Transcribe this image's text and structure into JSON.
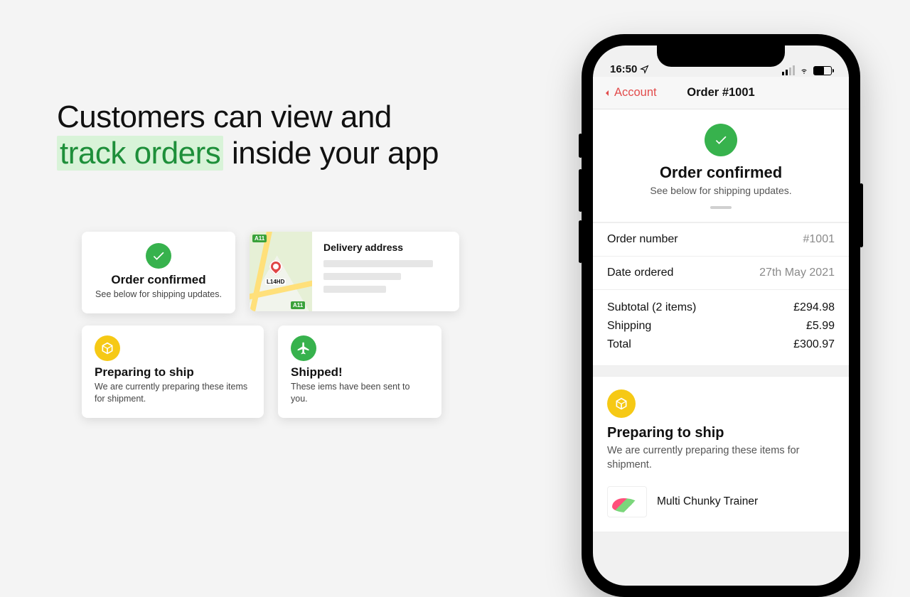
{
  "headline": {
    "part1": "Customers can view and",
    "emph": "track orders",
    "part2": "inside your app"
  },
  "cards": {
    "confirmed": {
      "title": "Order confirmed",
      "sub": "See below for shipping updates."
    },
    "delivery": {
      "title": "Delivery address",
      "postcode": "L14HD",
      "road_badge": "A11"
    },
    "preparing": {
      "title": "Preparing to ship",
      "sub": "We are currently preparing these items for shipment."
    },
    "shipped": {
      "title": "Shipped!",
      "sub": "These iems have been sent to you."
    }
  },
  "phone": {
    "status": {
      "time": "16:50"
    },
    "nav": {
      "back": "Account",
      "title": "Order #1001"
    },
    "hero": {
      "title": "Order confirmed",
      "sub": "See below for shipping updates."
    },
    "rows": {
      "order_number": {
        "label": "Order number",
        "value": "#1001"
      },
      "date": {
        "label": "Date ordered",
        "value": "27th May 2021"
      }
    },
    "totals": {
      "subtotal": {
        "label": "Subtotal (2 items)",
        "value": "£294.98"
      },
      "shipping": {
        "label": "Shipping",
        "value": "£5.99"
      },
      "total": {
        "label": "Total",
        "value": "£300.97"
      }
    },
    "ship": {
      "title": "Preparing to ship",
      "sub": "We are currently preparing these items for shipment."
    },
    "product": {
      "name": "Multi Chunky Trainer"
    }
  }
}
